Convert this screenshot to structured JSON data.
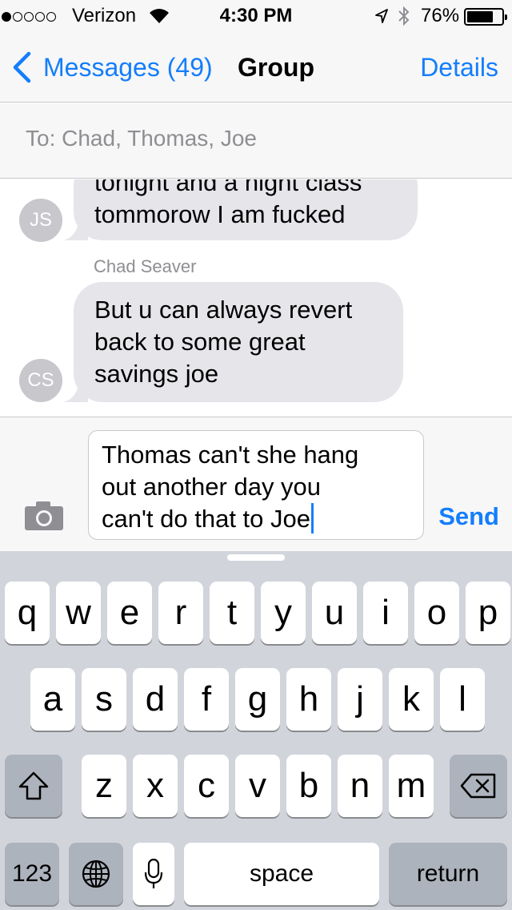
{
  "status_bar": {
    "carrier": "Verizon",
    "time": "4:30 PM",
    "battery_percent": "76%",
    "battery_level": 0.76,
    "signal_bars_filled": 1,
    "signal_bars_total": 5,
    "icons": [
      "signal-dots-icon",
      "wifi-icon",
      "location-arrow-icon",
      "bluetooth-icon",
      "battery-icon"
    ]
  },
  "nav": {
    "back_label": "Messages (49)",
    "title": "Group",
    "details_label": "Details"
  },
  "recipients": {
    "text": "To: Chad, Thomas, Joe"
  },
  "thread": {
    "messages": [
      {
        "initials": "JS",
        "lines": [
          "tonight and a night class",
          "tommorow I am fucked"
        ]
      },
      {
        "sender": "Chad Seaver",
        "initials": "CS",
        "lines": [
          "But u can always revert",
          "back to some great",
          "savings joe"
        ]
      }
    ]
  },
  "compose": {
    "lines": [
      "Thomas can't she hang",
      "out another day you",
      "can't do that to Joe"
    ],
    "send_label": "Send",
    "camera_icon": "camera-icon"
  },
  "keyboard": {
    "row1": [
      "q",
      "w",
      "e",
      "r",
      "t",
      "y",
      "u",
      "i",
      "o",
      "p"
    ],
    "row2": [
      "a",
      "s",
      "d",
      "f",
      "g",
      "h",
      "j",
      "k",
      "l"
    ],
    "row3": [
      "z",
      "x",
      "c",
      "v",
      "b",
      "n",
      "m"
    ],
    "numbers_label": "123",
    "space_label": "space",
    "return_label": "return",
    "shift_icon": "shift-icon",
    "delete_icon": "delete-icon",
    "globe_icon": "globe-icon",
    "mic_icon": "microphone-icon"
  },
  "colors": {
    "accent": "#147efb",
    "bubble_gray": "#e5e5ea",
    "avatar_gray": "#c7c7cc",
    "keyboard_bg": "#d1d5db",
    "secondary_text": "#8e8e93"
  }
}
